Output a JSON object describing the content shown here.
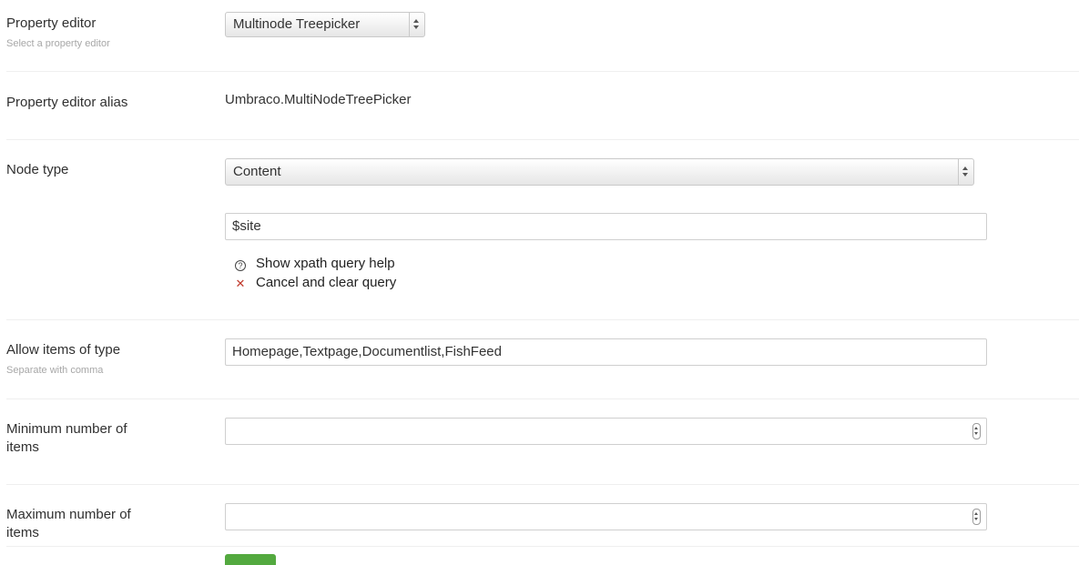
{
  "property_editor": {
    "label": "Property editor",
    "description": "Select a property editor",
    "selected": "Multinode Treepicker"
  },
  "property_editor_alias": {
    "label": "Property editor alias",
    "value": "Umbraco.MultiNodeTreePicker"
  },
  "node_type": {
    "label": "Node type",
    "selected": "Content",
    "query_value": "$site",
    "show_help_label": "Show xpath query help",
    "cancel_label": "Cancel and clear query",
    "help_icon_glyph": "?",
    "cancel_icon_glyph": "✕"
  },
  "allow_items": {
    "label": "Allow items of type",
    "description": "Separate with comma",
    "value": "Homepage,Textpage,Documentlist,FishFeed"
  },
  "minimum_items": {
    "label_line1": "Minimum number of",
    "label_line2": "items",
    "value": ""
  },
  "maximum_items": {
    "label_line1": "Maximum number of",
    "label_line2": "items",
    "value": ""
  },
  "colors": {
    "cancel_icon": "#c0392b",
    "save_button": "#53a93f"
  }
}
